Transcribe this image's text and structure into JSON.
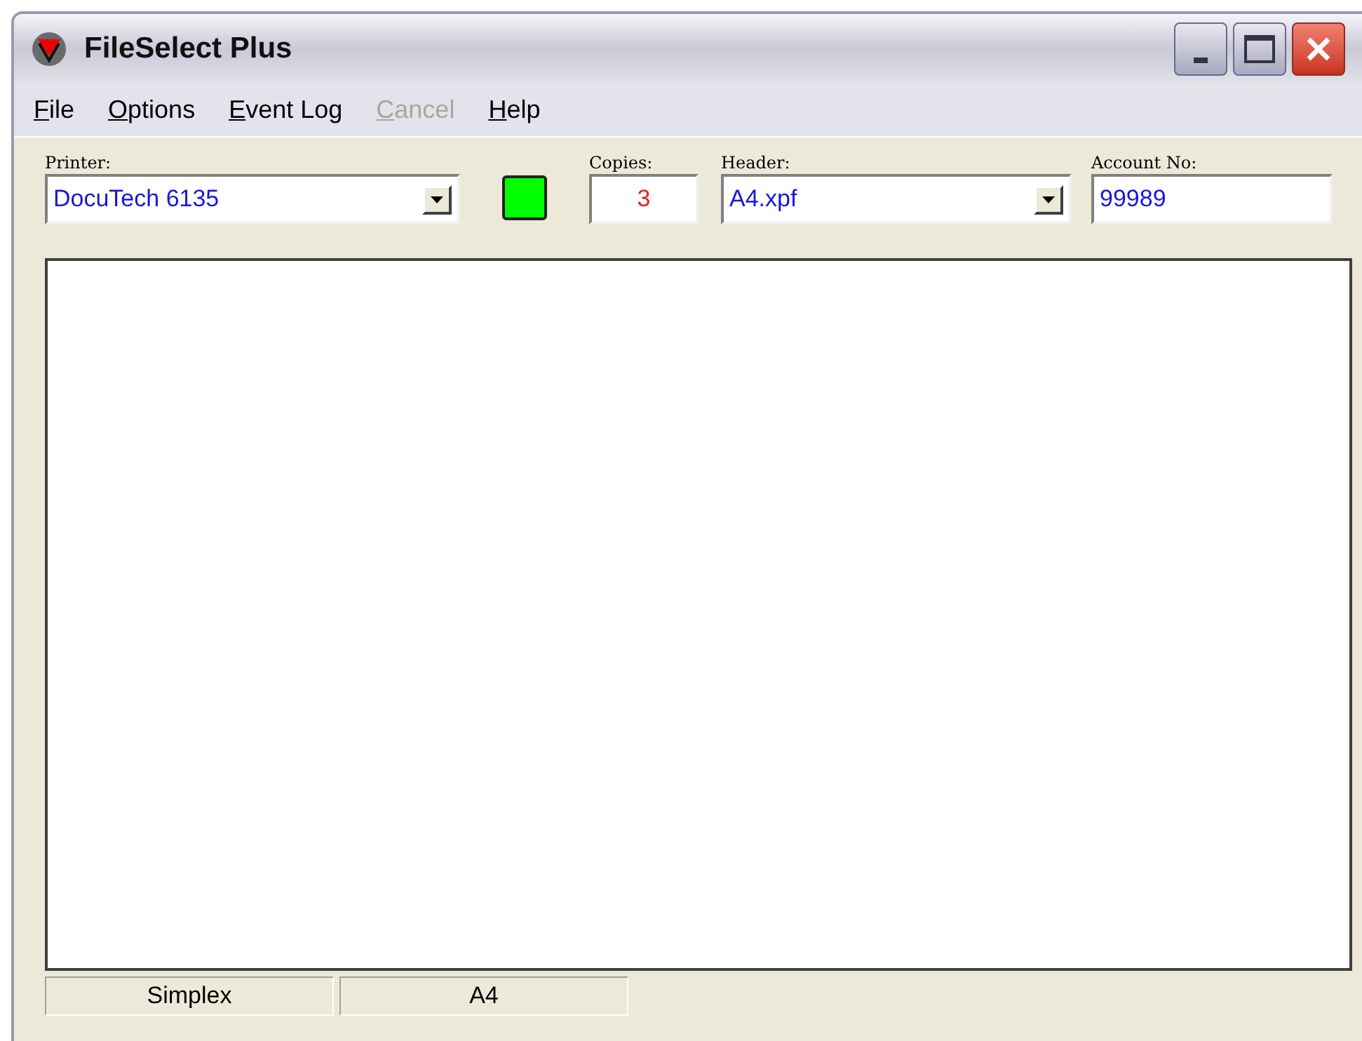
{
  "window": {
    "title": "FileSelect Plus"
  },
  "menu": [
    {
      "label": "File",
      "disabled": false
    },
    {
      "label": "Options",
      "disabled": false
    },
    {
      "label": "Event Log",
      "disabled": false
    },
    {
      "label": "Cancel",
      "disabled": true
    },
    {
      "label": "Help",
      "disabled": false
    }
  ],
  "toolbar": {
    "printer": {
      "label": "Printer:",
      "value": "DocuTech 6135"
    },
    "status_light": {
      "color": "#00ff00"
    },
    "copies": {
      "label": "Copies:",
      "value": "3"
    },
    "header": {
      "label": "Header:",
      "value": "A4.xpf"
    },
    "account": {
      "label": "Account No:",
      "value": "99989"
    }
  },
  "status_bar": [
    "Simplex",
    "A4"
  ]
}
